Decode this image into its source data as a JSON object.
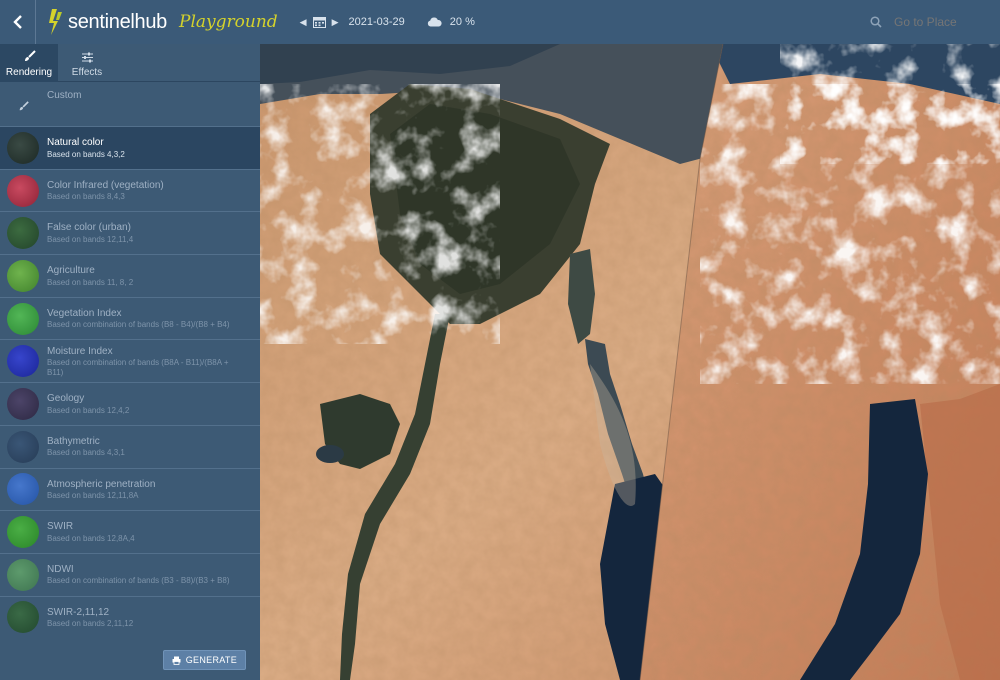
{
  "header": {
    "logo_text": "sentinelhub",
    "logo_sub": "Playground",
    "date": "2021-03-29",
    "cloud_coverage": "20 %",
    "search_placeholder": "Go to Place"
  },
  "tabs": [
    {
      "label": "Rendering",
      "active": true
    },
    {
      "label": "Effects",
      "active": false
    }
  ],
  "layers": [
    {
      "name": "Custom",
      "desc": "",
      "color": "",
      "selected": false
    },
    {
      "name": "Natural color",
      "desc": "Based on bands 4,3,2",
      "color": "#23312d",
      "selected": true
    },
    {
      "name": "Color Infrared (vegetation)",
      "desc": "Based on bands 8,4,3",
      "color": "#b7344a",
      "selected": false
    },
    {
      "name": "False color (urban)",
      "desc": "Based on bands 12,11,4",
      "color": "#2f5a35",
      "selected": false
    },
    {
      "name": "Agriculture",
      "desc": "Based on bands 11, 8, 2",
      "color": "#5a9e3e",
      "selected": false
    },
    {
      "name": "Vegetation Index",
      "desc": "Based on combination of bands (B8 - B4)/(B8 + B4)",
      "color": "#3ea043",
      "selected": false
    },
    {
      "name": "Moisture Index",
      "desc": "Based on combination of bands (B8A - B11)/(B8A + B11)",
      "color": "#2533b8",
      "selected": false
    },
    {
      "name": "Geology",
      "desc": "Based on bands 12,4,2",
      "color": "#3e3656",
      "selected": false
    },
    {
      "name": "Bathymetric",
      "desc": "Based on bands 4,3,1",
      "color": "#324a67",
      "selected": false
    },
    {
      "name": "Atmospheric penetration",
      "desc": "Based on bands 12,11,8A",
      "color": "#3466bc",
      "selected": false
    },
    {
      "name": "SWIR",
      "desc": "Based on bands 12,8A,4",
      "color": "#3a9c3a",
      "selected": false
    },
    {
      "name": "NDWI",
      "desc": "Based on combination of bands (B3 - B8)/(B3 + B8)",
      "color": "#4f8a5e",
      "selected": false
    },
    {
      "name": "SWIR-2,11,12",
      "desc": "Based on bands 2,11,12",
      "color": "#2f5b3a",
      "selected": false
    }
  ],
  "generate_label": "GENERATE"
}
